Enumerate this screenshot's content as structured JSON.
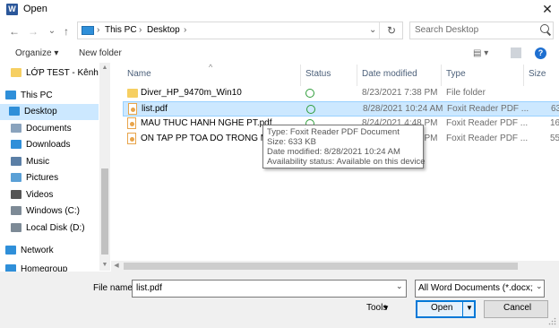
{
  "window": {
    "title": "Open",
    "app_icon_letter": "W",
    "close_glyph": "✕"
  },
  "nav_buttons": {
    "back": "←",
    "forward": "→",
    "recent": "⌄",
    "up": "↑"
  },
  "address": {
    "crumbs": [
      "This PC",
      "Desktop"
    ],
    "separator": "›",
    "dropdown_glyph": "⌄",
    "refresh_glyph": "↻"
  },
  "search": {
    "placeholder": "Search Desktop"
  },
  "toolbar": {
    "organize": "Organize ▾",
    "new_folder": "New folder",
    "view_glyph": "▤ ▾",
    "help_glyph": "?"
  },
  "navigation": {
    "items": [
      {
        "label": "LỚP TEST - Kênh",
        "icon": "folder-icon",
        "color": "#f6cf62",
        "selected": false
      },
      {
        "label": "This PC",
        "icon": "computer-icon",
        "color": "#2f8fd9",
        "selected": false
      },
      {
        "label": "Desktop",
        "icon": "desktop-icon",
        "color": "#2f8fd9",
        "selected": true
      },
      {
        "label": "Documents",
        "icon": "documents-icon",
        "color": "#8aa3bd",
        "selected": false
      },
      {
        "label": "Downloads",
        "icon": "downloads-icon",
        "color": "#2f8fd9",
        "selected": false
      },
      {
        "label": "Music",
        "icon": "music-icon",
        "color": "#5b7fa6",
        "selected": false
      },
      {
        "label": "Pictures",
        "icon": "pictures-icon",
        "color": "#5aa0d6",
        "selected": false
      },
      {
        "label": "Videos",
        "icon": "videos-icon",
        "color": "#555555",
        "selected": false
      },
      {
        "label": "Windows (C:)",
        "icon": "drive-icon",
        "color": "#7d8a96",
        "selected": false
      },
      {
        "label": "Local Disk (D:)",
        "icon": "drive-icon",
        "color": "#7d8a96",
        "selected": false
      },
      {
        "label": "Network",
        "icon": "network-icon",
        "color": "#2f8fd9",
        "selected": false
      },
      {
        "label": "Homegroup",
        "icon": "homegroup-icon",
        "color": "#2f8fd9",
        "selected": false
      }
    ]
  },
  "columns": {
    "name": "Name",
    "status": "Status",
    "date": "Date modified",
    "type": "Type",
    "size": "Size"
  },
  "files": [
    {
      "name": "Diver_HP_9470m_Win10",
      "kind": "folder",
      "date": "8/23/2021 7:38 PM",
      "type": "File folder",
      "size": "",
      "selected": false
    },
    {
      "name": "list.pdf",
      "kind": "pdf",
      "date": "8/28/2021 10:24 AM",
      "type": "Foxit Reader PDF ...",
      "size": "63",
      "selected": true
    },
    {
      "name": "MAU THUC HANH NGHE PT.pdf",
      "kind": "pdf",
      "date": "8/24/2021 4:48 PM",
      "type": "Foxit Reader PDF ...",
      "size": "16",
      "selected": false
    },
    {
      "name": "ON TAP PP TOA DO TRONG MP -",
      "kind": "pdf",
      "date": "8/24/2021 4:48 PM",
      "type": "Foxit Reader PDF ...",
      "size": "55",
      "selected": false
    }
  ],
  "tooltip": {
    "type": "Type: Foxit Reader PDF Document",
    "size": "Size: 633 KB",
    "date": "Date modified: 8/28/2021 10:24 AM",
    "availability": "Availability status: Available on this device"
  },
  "footer": {
    "file_name_label": "File name:",
    "file_name_value": "list.pdf",
    "file_type_value": "All Word Documents (*.docx;*.d",
    "tools": "Tools",
    "open": "Open",
    "cancel": "Cancel"
  },
  "colors": {
    "selection": "#cce8ff",
    "accent": "#0078d7",
    "status_ok": "#2e9d3a"
  }
}
